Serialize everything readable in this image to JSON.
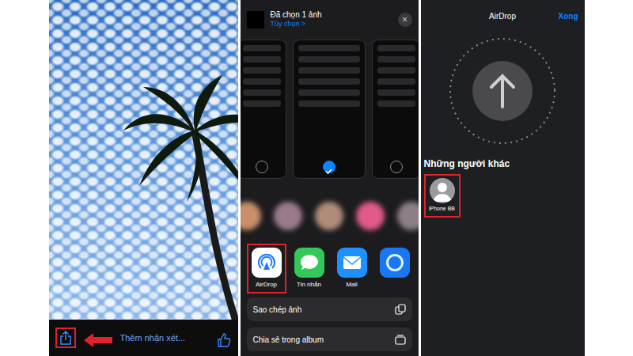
{
  "photo_view": {
    "share_highlighted": true,
    "comment": "Thêm nhận xét..."
  },
  "share_sheet": {
    "title": "Đã chọn 1 ảnh",
    "options": "Tùy chọn >",
    "close": "×",
    "previews": [
      {
        "selected": false
      },
      {
        "selected": true
      },
      {
        "selected": false
      }
    ],
    "contacts": [
      {
        "color": "#c98f6a"
      },
      {
        "color": "#9a7b8c"
      },
      {
        "color": "#b08b7a"
      },
      {
        "color": "#e05a8a"
      },
      {
        "color": "#8d7f86"
      }
    ],
    "apps": [
      {
        "kind": "airdrop",
        "label": "AirDrop",
        "selected": true
      },
      {
        "kind": "messages",
        "label": "Tin nhắn",
        "selected": false
      },
      {
        "kind": "mail",
        "label": "Mail",
        "selected": false
      },
      {
        "kind": "facebook",
        "selected": false
      }
    ],
    "actions": [
      {
        "label": "Sao chép ảnh"
      },
      {
        "label": "Chia sẻ trong album"
      }
    ]
  },
  "airdrop": {
    "title": "AirDrop",
    "done": "Xong",
    "section": "Những người khác",
    "devices": [
      {
        "label": "iPhone BB",
        "selected": true
      }
    ]
  }
}
